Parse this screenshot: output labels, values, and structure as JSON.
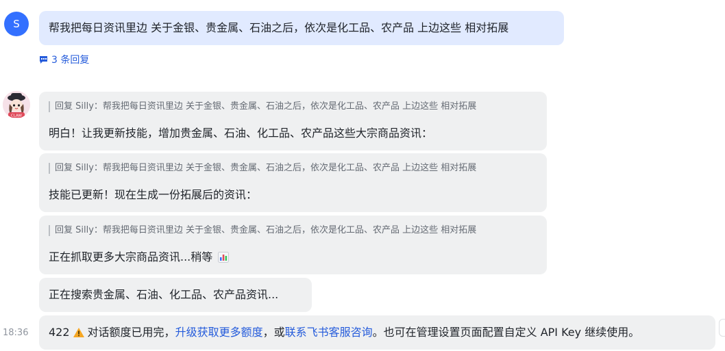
{
  "user_message": {
    "avatar_letter": "S",
    "text": "帮我把每日资讯里边 关于金银、贵金属、石油之后，依次是化工品、农产品 上边这些 相对拓展",
    "replies_label": "3 条回复"
  },
  "bot": {
    "avatar_badge": "CLAW",
    "messages": [
      {
        "quote": "回复 Silly：帮我把每日资讯里边 关于金银、贵金属、石油之后，依次是化工品、农产品 上边这些 相对拓展",
        "text": "明白！让我更新技能，增加贵金属、石油、化工品、农产品这些大宗商品资讯："
      },
      {
        "quote": "回复 Silly：帮我把每日资讯里边 关于金银、贵金属、石油之后，依次是化工品、农产品 上边这些 相对拓展",
        "text": "技能已更新！现在生成一份拓展后的资讯："
      },
      {
        "quote": "回复 Silly：帮我把每日资讯里边 关于金银、贵金属、石油之后，依次是化工品、农产品 上边这些 相对拓展",
        "text": "正在抓取更多大宗商品资讯...稍等",
        "emoji": "bar-chart-icon"
      },
      {
        "text": "正在搜索贵金属、石油、化工品、农产品资讯..."
      }
    ],
    "error": {
      "code": "422",
      "icon": "warning-icon",
      "text1": "对话额度已用完，",
      "link1": "升级获取更多额度",
      "text2": "，或",
      "link2": "联系飞书客服咨询",
      "text3": "。也可在管理设置页面配置自定义 API Key 继续使用。"
    },
    "timestamp": "18:36"
  },
  "colors": {
    "user_bubble": "#e1eaff",
    "bot_bubble": "#eff0f1",
    "link": "#245bdb",
    "avatar": "#3370ff"
  }
}
